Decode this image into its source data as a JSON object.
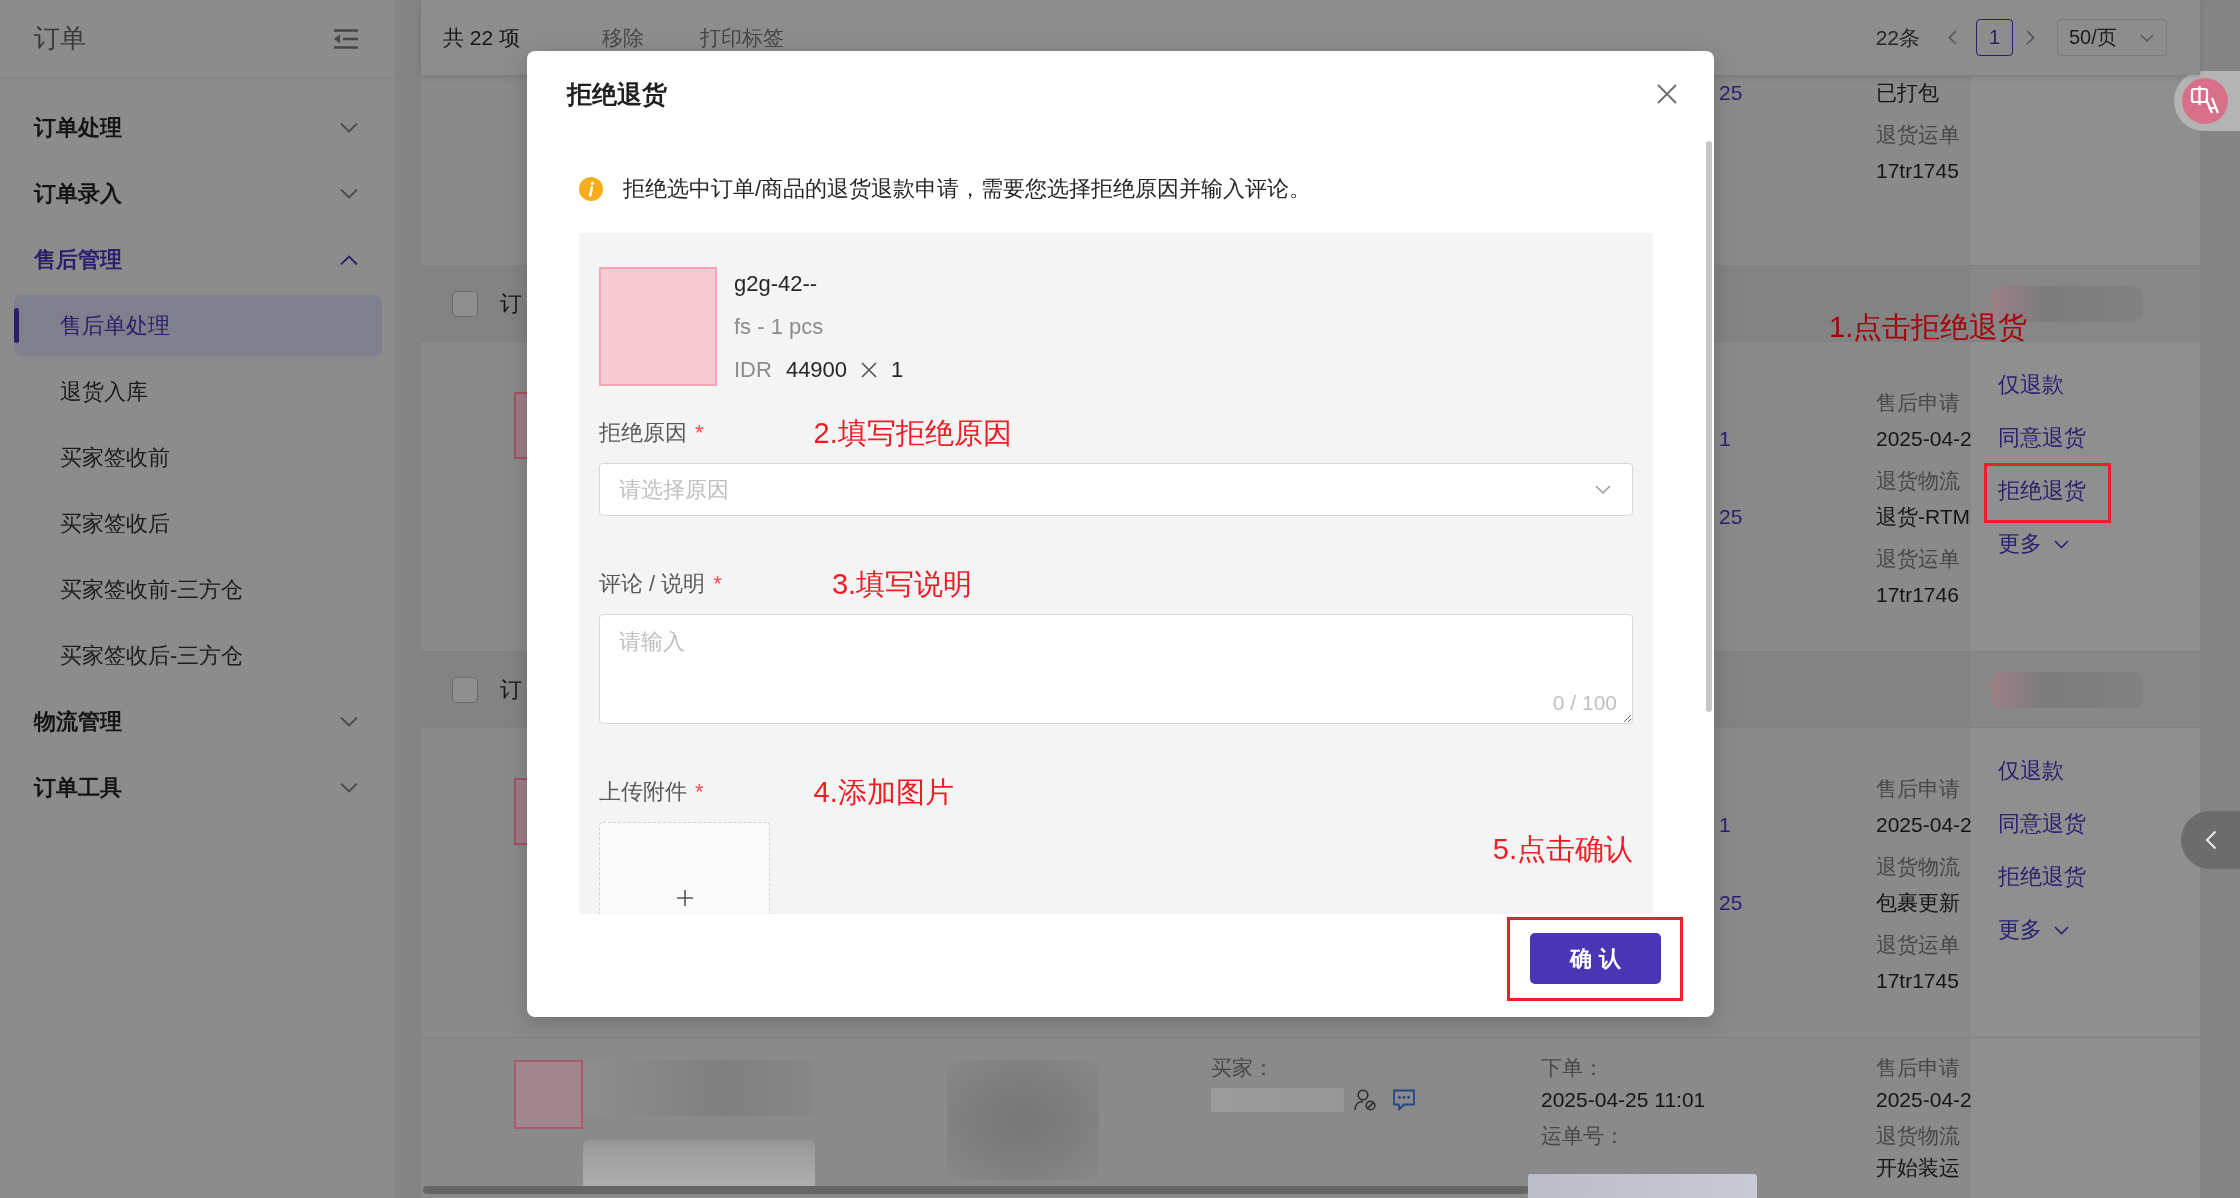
{
  "sidebar": {
    "title": "订单",
    "menu": [
      {
        "label": "订单处理",
        "expanded": false
      },
      {
        "label": "订单录入",
        "expanded": false
      },
      {
        "label": "售后管理",
        "expanded": true,
        "children": [
          {
            "label": "售后单处理",
            "selected": true
          },
          {
            "label": "退货入库",
            "selected": false
          },
          {
            "label": "买家签收前",
            "selected": false
          },
          {
            "label": "买家签收后",
            "selected": false
          },
          {
            "label": "买家签收前-三方仓",
            "selected": false
          },
          {
            "label": "买家签收后-三方仓",
            "selected": false
          }
        ]
      },
      {
        "label": "物流管理",
        "expanded": false
      },
      {
        "label": "订单工具",
        "expanded": false
      }
    ]
  },
  "toolbar": {
    "count": "共 22 项",
    "actions": [
      "移除",
      "打印标签"
    ],
    "pagination": {
      "total": "22条",
      "pages": [
        {
          "label": "1",
          "selected": true
        }
      ],
      "page_size": "50/页"
    }
  },
  "table": {
    "rows": [
      {
        "kind": "tail",
        "column_1": [
          "25"
        ],
        "after_sales": [
          {
            "kind": "value",
            "text": "已打包"
          },
          {
            "kind": "label",
            "text": "退货运单"
          },
          {
            "kind": "value",
            "text": "17tr1745"
          }
        ]
      },
      {
        "kind": "group",
        "checked": false,
        "title": "订"
      },
      {
        "kind": "item",
        "column_1": [
          "1",
          "25"
        ],
        "after_sales": [
          {
            "kind": "label",
            "text": "售后申请"
          },
          {
            "kind": "value",
            "text": "2025-04-2"
          },
          {
            "kind": "label",
            "text": "退货物流"
          },
          {
            "kind": "value",
            "text": "退货-RTM"
          },
          {
            "kind": "label",
            "text": "退货运单"
          },
          {
            "kind": "value",
            "text": "17tr1746"
          }
        ],
        "annotation": "1.点击拒绝退货",
        "actions": [
          {
            "kind": "link",
            "label": "仅退款",
            "highlighted": false
          },
          {
            "kind": "link",
            "label": "同意退货",
            "highlighted": false
          },
          {
            "kind": "link",
            "label": "拒绝退货",
            "highlighted": true
          },
          {
            "kind": "menu",
            "label": "更多",
            "highlighted": false
          }
        ]
      },
      {
        "kind": "group",
        "checked": false,
        "title": "订"
      },
      {
        "kind": "item",
        "column_1": [
          "1",
          "25"
        ],
        "after_sales": [
          {
            "kind": "label",
            "text": "售后申请"
          },
          {
            "kind": "value",
            "text": "2025-04-2"
          },
          {
            "kind": "label",
            "text": "退货物流"
          },
          {
            "kind": "value",
            "text": "包裹更新"
          },
          {
            "kind": "label",
            "text": "退货运单"
          },
          {
            "kind": "value",
            "text": "17tr1745"
          }
        ],
        "actions": [
          {
            "kind": "link",
            "label": "仅退款",
            "highlighted": false
          },
          {
            "kind": "link",
            "label": "同意退货",
            "highlighted": false
          },
          {
            "kind": "link",
            "label": "拒绝退货",
            "highlighted": false
          },
          {
            "kind": "menu",
            "label": "更多",
            "highlighted": false
          }
        ]
      },
      {
        "kind": "full",
        "buyer_label": "买家：",
        "order": [
          {
            "kind": "label",
            "text": "下单："
          },
          {
            "kind": "value",
            "text": "2025-04-25 11:01"
          },
          {
            "kind": "label",
            "text": "运单号："
          }
        ],
        "after_sales": [
          {
            "kind": "label",
            "text": "售后申请"
          },
          {
            "kind": "value",
            "text": "2025-04-2"
          },
          {
            "kind": "label",
            "text": "退货物流"
          },
          {
            "kind": "value",
            "text": "开始装运"
          }
        ]
      }
    ]
  },
  "dialog": {
    "title": "拒绝退货",
    "notice": "拒绝选中订单/商品的退货退款申请，需要您选择拒绝原因并输入评论。",
    "product": {
      "name": "g2g-42--",
      "variant": "fs - 1 pcs",
      "currency": "IDR",
      "price": "44900",
      "quantity": "1"
    },
    "fields": [
      {
        "kind": "select",
        "label": "拒绝原因",
        "required_mark": "*",
        "annotation": "2.填写拒绝原因",
        "placeholder": "请选择原因"
      },
      {
        "kind": "textarea",
        "label": "评论 / 说明",
        "required_mark": "*",
        "annotation": "3.填写说明",
        "placeholder": "请输入",
        "counter": "0 / 100"
      },
      {
        "kind": "upload",
        "label": "上传附件",
        "required_mark": "*",
        "annotation": "4.添加图片"
      }
    ],
    "confirm": {
      "label": "确 认",
      "highlighted": true,
      "annotation": "5.点击确认"
    }
  }
}
